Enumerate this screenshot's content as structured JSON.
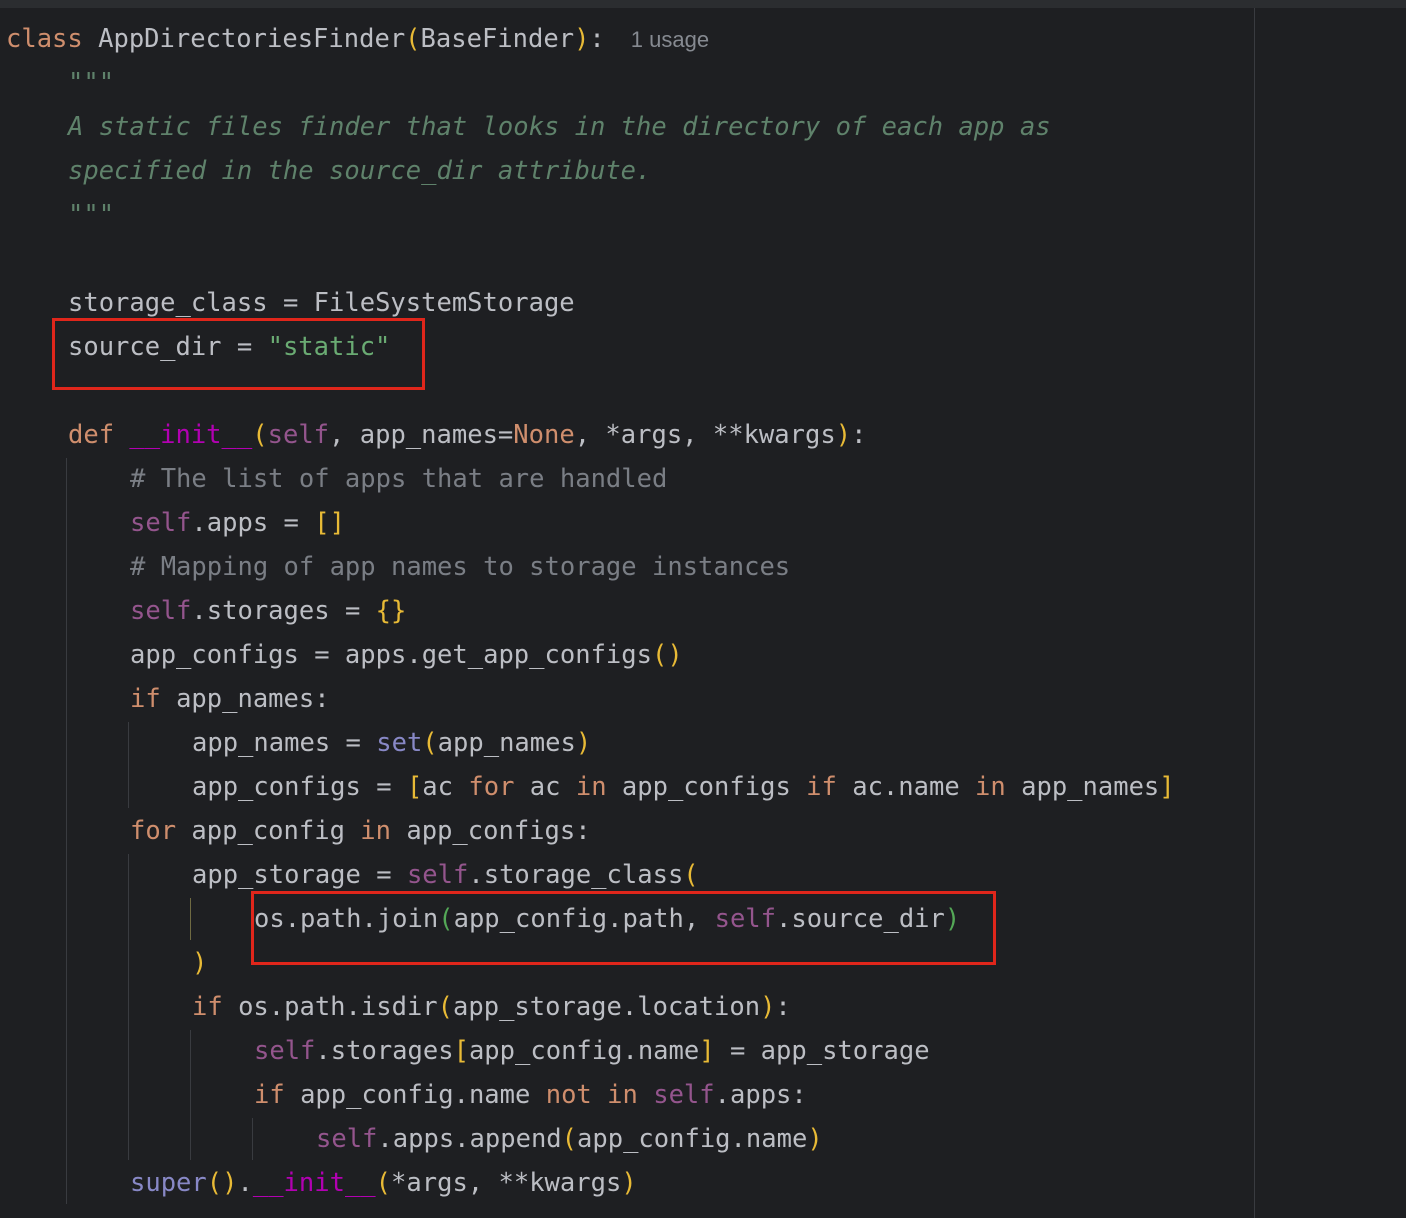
{
  "code": {
    "l1_class_kw": "class",
    "l1_name": "AppDirectoriesFinder",
    "l1_base": "BaseFinder",
    "l1_usage_hint": "1 usage",
    "l2_doc_open": "\"\"\"",
    "l3_doc": "A static files finder that looks in the directory of each app as",
    "l4_doc": "specified in the source_dir attribute.",
    "l5_doc_close": "\"\"\"",
    "l7_storage_class_name": "storage_class",
    "l7_storage_class_value": "FileSystemStorage",
    "l8_source_dir_name": "source_dir",
    "l8_source_dir_value": "\"static\"",
    "l10_def": "def",
    "l10_init": "__init__",
    "l10_params": "app_names=",
    "l10_none": "None",
    "l10_rest": ", *args, **kwargs",
    "l11_comment": "# The list of apps that are handled",
    "l12_attr": ".apps = ",
    "l13_comment": "# Mapping of app names to storage instances",
    "l14_attr": ".storages = ",
    "l15_code": "app_configs = apps.get_app_configs",
    "l16_if": "if",
    "l16_rest": " app_names:",
    "l17_code": "app_names = ",
    "l17_set": "set",
    "l17_arg": "app_names",
    "l18_code": "app_configs = ",
    "l18_ac": "ac ",
    "l18_for": "for",
    "l18_ac2": " ac ",
    "l18_in": "in",
    "l18_configs": " app_configs ",
    "l18_if": "if",
    "l18_name": " ac.name ",
    "l18_in2": "in",
    "l18_names": " app_names",
    "l19_for": "for",
    "l19_var": " app_config ",
    "l19_in": "in",
    "l19_rest": " app_configs:",
    "l20_code": "app_storage = ",
    "l20_attr": ".storage_class",
    "l21_join": "os.path.join",
    "l21_arg": "app_config.path, ",
    "l21_attr": ".source_dir",
    "l23_if": "if",
    "l23_code": " os.path.isdir",
    "l23_arg": "app_storage.location",
    "l24_attr": ".storages",
    "l24_key": "app_config.name",
    "l24_rest": " = app_storage",
    "l25_if": "if",
    "l25_code": " app_config.name ",
    "l25_not": "not",
    "l25_in": "in",
    "l25_attr": ".apps:",
    "l26_attr": ".apps.append",
    "l26_arg": "app_config.name",
    "l27_super": "super",
    "l27_init": "__init__",
    "l27_args": "*args, **kwargs",
    "self_kw": "self"
  },
  "colors": {
    "background": "#1e1f22",
    "keyword": "#cf8e6d",
    "function": "#56a8f5",
    "string": "#6aab73",
    "self": "#94558d",
    "docstring": "#5f826b",
    "comment": "#7a7e85",
    "highlight_box": "#e0261b"
  }
}
